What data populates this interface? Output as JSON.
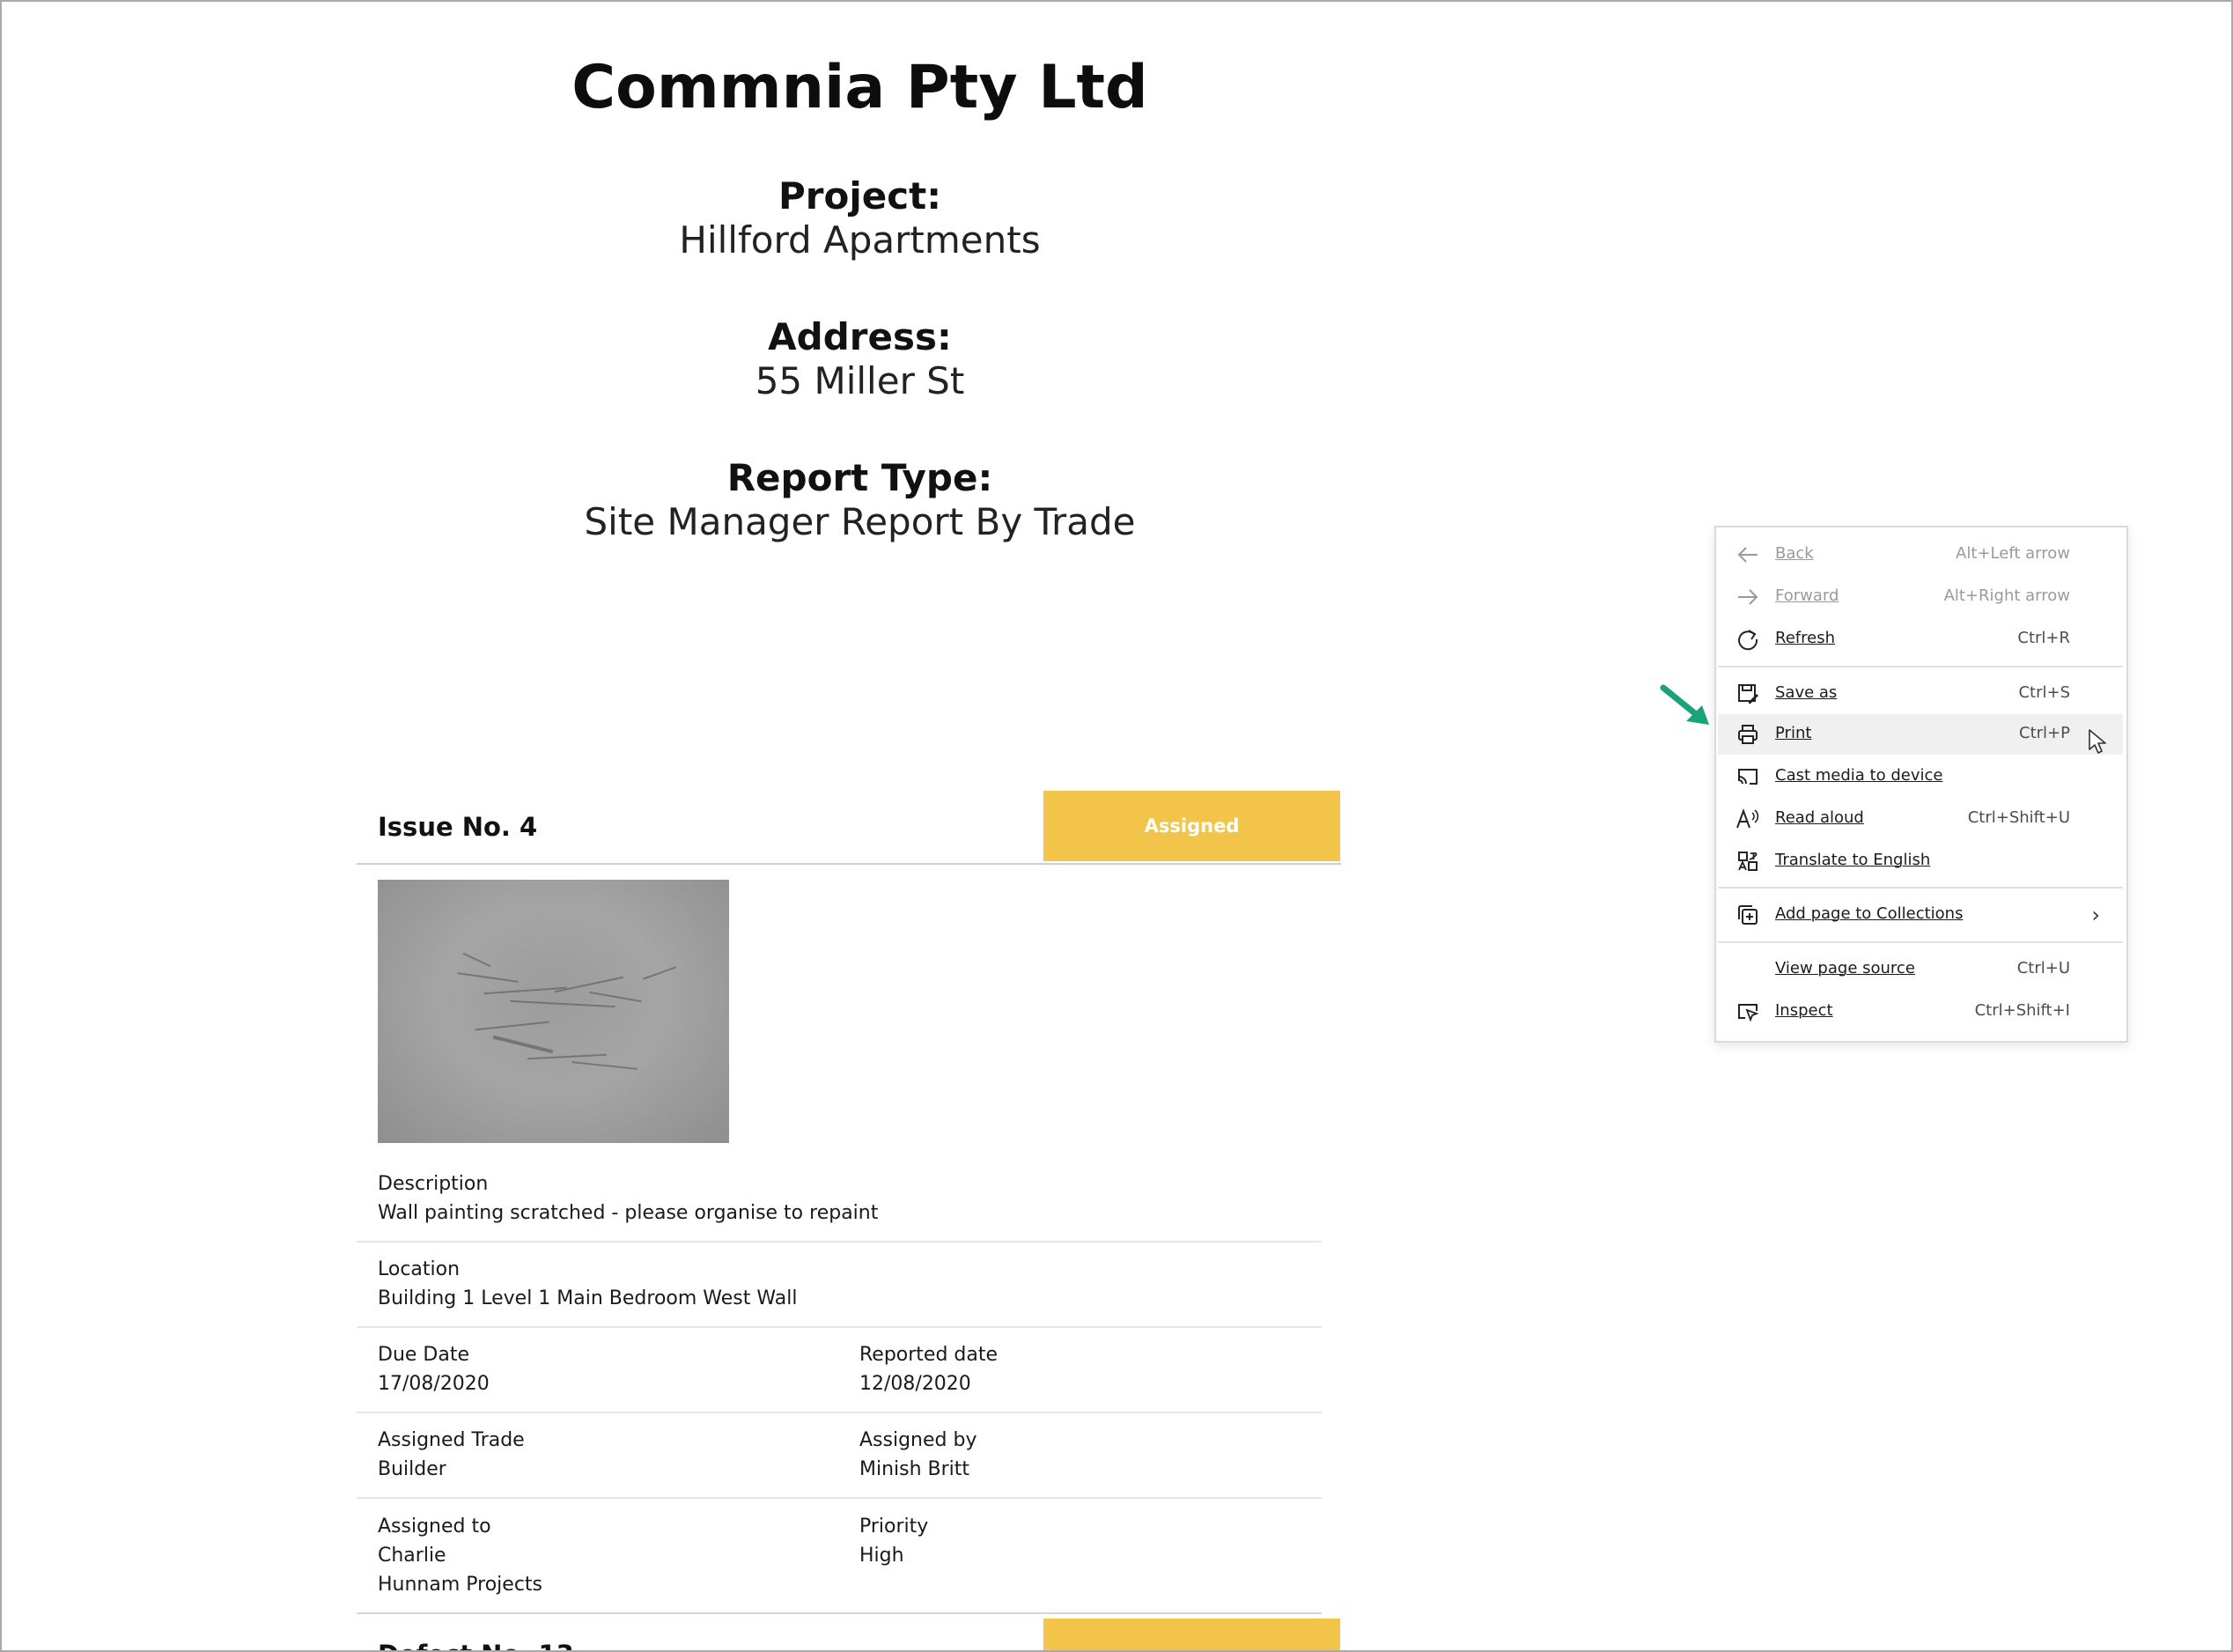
{
  "report": {
    "company": "Commnia Pty Ltd",
    "project_label": "Project:",
    "project_value": "Hillford Apartments",
    "address_label": "Address:",
    "address_value": "55 Miller St",
    "report_type_label": "Report Type:",
    "report_type_value": "Site Manager Report By Trade"
  },
  "issue": {
    "title": "Issue No. 4",
    "status": "Assigned",
    "status_color": "#f2c54a",
    "description_label": "Description",
    "description": "Wall painting scratched - please organise to repaint",
    "location_label": "Location",
    "location": "Building 1 Level 1 Main Bedroom West Wall",
    "due_date_label": "Due Date",
    "due_date": "17/08/2020",
    "reported_date_label": "Reported date",
    "reported_date": "12/08/2020",
    "assigned_trade_label": "Assigned Trade",
    "assigned_trade": "Builder",
    "assigned_by_label": "Assigned by",
    "assigned_by": "Minish Britt",
    "assigned_to_label": "Assigned to",
    "assigned_to_name": "Charlie",
    "assigned_to_company": "Hunnam Projects",
    "priority_label": "Priority",
    "priority": "High"
  },
  "next_item": {
    "title": "Defect No. 13"
  },
  "context_menu": {
    "items": [
      {
        "label": "Back",
        "shortcut": "Alt+Left arrow",
        "icon": "arrow-left-icon",
        "disabled": true
      },
      {
        "label": "Forward",
        "shortcut": "Alt+Right arrow",
        "icon": "arrow-right-icon",
        "disabled": true
      },
      {
        "label": "Refresh",
        "shortcut": "Ctrl+R",
        "icon": "refresh-icon"
      },
      {
        "label": "Save as",
        "shortcut": "Ctrl+S",
        "icon": "save-icon"
      },
      {
        "label": "Print",
        "shortcut": "Ctrl+P",
        "icon": "print-icon",
        "highlighted": true
      },
      {
        "label": "Cast media to device",
        "shortcut": "",
        "icon": "cast-icon"
      },
      {
        "label": "Read aloud",
        "shortcut": "Ctrl+Shift+U",
        "icon": "read-aloud-icon"
      },
      {
        "label": "Translate to English",
        "shortcut": "",
        "icon": "translate-icon"
      },
      {
        "label": "Add page to Collections",
        "shortcut": "",
        "icon": "collections-icon",
        "submenu": true
      },
      {
        "label": "View page source",
        "shortcut": "Ctrl+U",
        "icon": ""
      },
      {
        "label": "Inspect",
        "shortcut": "Ctrl+Shift+I",
        "icon": "inspect-icon"
      }
    ]
  },
  "colors": {
    "annotation_arrow": "#1aa37a",
    "menu_hover": "#f0f0f0"
  }
}
